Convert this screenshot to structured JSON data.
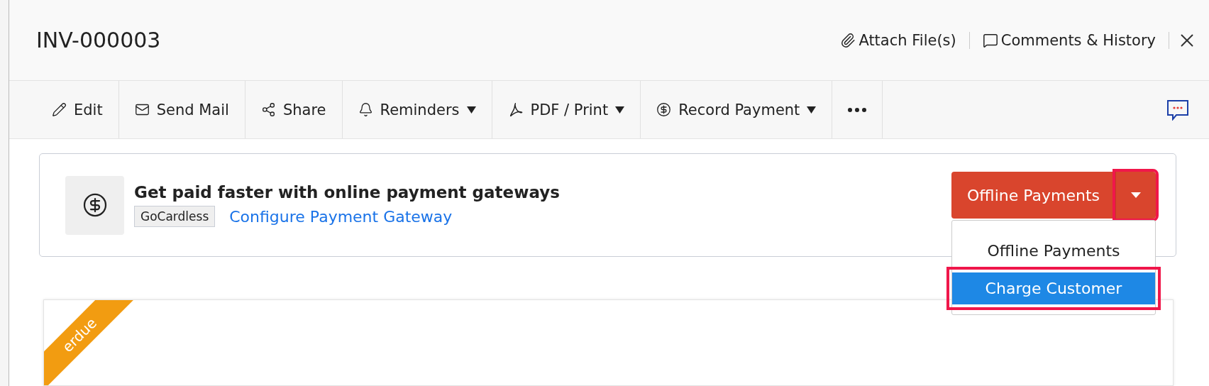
{
  "header": {
    "title": "INV-000003",
    "actions": [
      {
        "label": "Attach File(s)"
      },
      {
        "label": "Comments & History"
      }
    ]
  },
  "toolbar": [
    {
      "label": "Edit",
      "dropdown": false
    },
    {
      "label": "Send Mail",
      "dropdown": false
    },
    {
      "label": "Share",
      "dropdown": false
    },
    {
      "label": "Reminders",
      "dropdown": true
    },
    {
      "label": "PDF / Print",
      "dropdown": true
    },
    {
      "label": "Record Payment",
      "dropdown": true
    }
  ],
  "banner": {
    "title": "Get paid faster with online payment gateways",
    "tag": "GoCardless",
    "link": "Configure Payment Gateway",
    "split_button": {
      "label": "Offline Payments",
      "caret_highlighted": true,
      "expanded": true
    },
    "menu": [
      {
        "label": "Offline Payments",
        "selected": false,
        "highlighted": false
      },
      {
        "label": "Charge Customer",
        "selected": true,
        "highlighted": true
      }
    ]
  },
  "invoice": {
    "ribbon": "erdue"
  }
}
